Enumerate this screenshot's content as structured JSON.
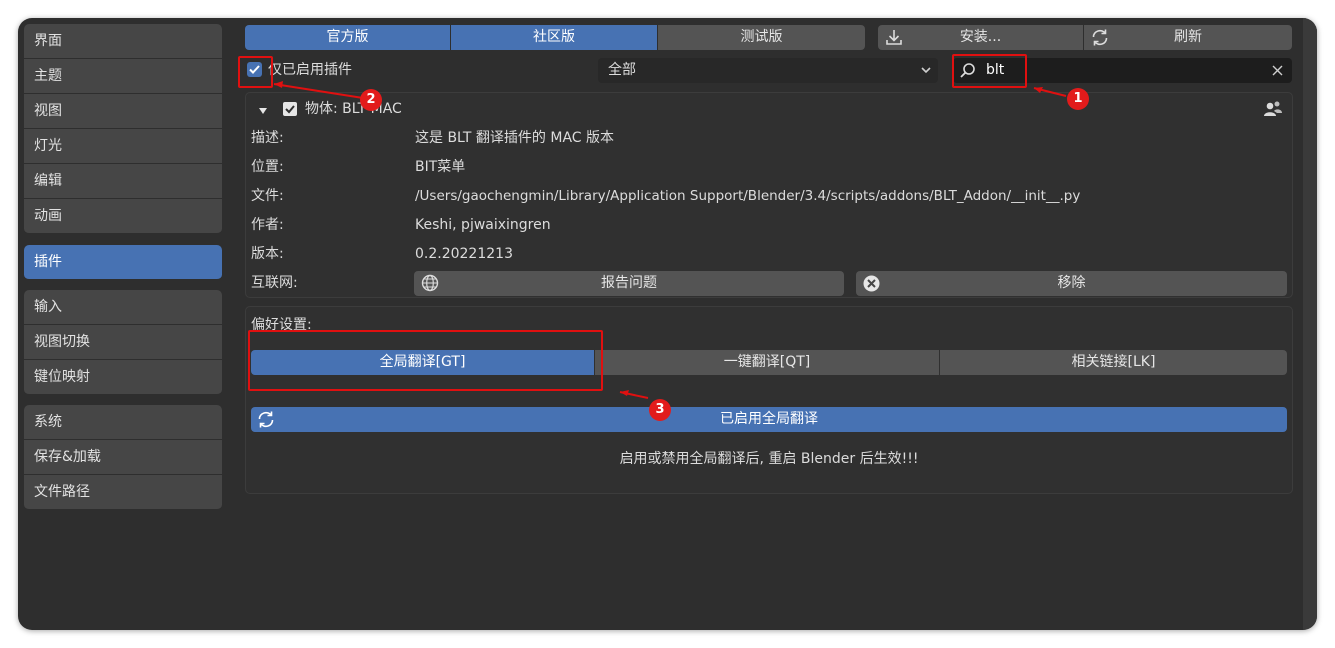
{
  "sidebar": {
    "items": [
      {
        "label": "界面",
        "active": false
      },
      {
        "label": "主题",
        "active": false
      },
      {
        "label": "视图",
        "active": false
      },
      {
        "label": "灯光",
        "active": false
      },
      {
        "label": "编辑",
        "active": false
      },
      {
        "label": "动画",
        "active": false
      },
      {
        "label": "插件",
        "active": true
      },
      {
        "label": "输入",
        "active": false
      },
      {
        "label": "视图切换",
        "active": false
      },
      {
        "label": "键位映射",
        "active": false
      },
      {
        "label": "系统",
        "active": false
      },
      {
        "label": "保存&加载",
        "active": false
      },
      {
        "label": "文件路径",
        "active": false
      }
    ]
  },
  "toolbar": {
    "tabs": [
      "官方版",
      "社区版",
      "测试版"
    ],
    "install_label": "安装...",
    "refresh_label": "刷新"
  },
  "filter": {
    "enabled_only_label": "仅已启用插件",
    "category_value": "全部",
    "search_value": "blt"
  },
  "addon": {
    "header": "物体: BLT MAC",
    "fields": [
      {
        "key": "描述:",
        "value": "这是 BLT 翻译插件的 MAC 版本"
      },
      {
        "key": "位置:",
        "value": "BIT菜单"
      },
      {
        "key": "文件:",
        "value": "/Users/gaochengmin/Library/Application Support/Blender/3.4/scripts/addons/BLT_Addon/__init__.py"
      },
      {
        "key": "作者:",
        "value": "Keshi, pjwaixingren"
      },
      {
        "key": "版本:",
        "value": "0.2.20221213"
      }
    ],
    "internet_label": "互联网:",
    "report_label": "报告问题",
    "remove_label": "移除"
  },
  "prefs": {
    "title": "偏好设置:",
    "tabs": [
      "全局翻译[GT]",
      "一键翻译[QT]",
      "相关链接[LK]"
    ],
    "enabled_button": "已启用全局翻译",
    "notice": "启用或禁用全局翻译后, 重启 Blender 后生效!!!"
  },
  "annotations": [
    "1",
    "2",
    "3"
  ],
  "colors": {
    "accent": "#4772b3",
    "annotation": "#e01010"
  }
}
